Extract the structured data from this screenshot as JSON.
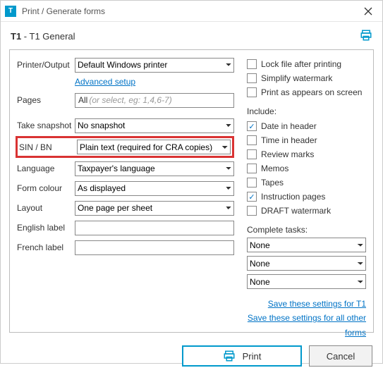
{
  "titlebar": {
    "title": "Print / Generate forms"
  },
  "subheader": {
    "code": "T1",
    "name": "T1 General"
  },
  "left": {
    "printerOutput": {
      "label": "Printer/Output",
      "value": "Default Windows printer"
    },
    "advancedSetup": "Advanced setup",
    "pages": {
      "label": "Pages",
      "prefix": "All",
      "hint": "(or select, eg: 1,4,6-7)"
    },
    "snapshot": {
      "label": "Take snapshot",
      "value": "No snapshot"
    },
    "sinbn": {
      "label": "SIN / BN",
      "value": "Plain text (required for CRA copies)"
    },
    "language": {
      "label": "Language",
      "value": "Taxpayer's language"
    },
    "formColour": {
      "label": "Form colour",
      "value": "As displayed"
    },
    "layout": {
      "label": "Layout",
      "value": "One page per sheet"
    },
    "englishLabel": {
      "label": "English label",
      "value": ""
    },
    "frenchLabel": {
      "label": "French label",
      "value": ""
    }
  },
  "right": {
    "top": [
      {
        "label": "Lock file after printing",
        "checked": false
      },
      {
        "label": "Simplify watermark",
        "checked": false
      },
      {
        "label": "Print as appears on screen",
        "checked": false
      }
    ],
    "includeLabel": "Include:",
    "include": [
      {
        "label": "Date in header",
        "checked": true
      },
      {
        "label": "Time in header",
        "checked": false
      },
      {
        "label": "Review marks",
        "checked": false
      },
      {
        "label": "Memos",
        "checked": false
      },
      {
        "label": "Tapes",
        "checked": false
      },
      {
        "label": "Instruction pages",
        "checked": true
      },
      {
        "label": "DRAFT watermark",
        "checked": false
      }
    ],
    "completeLabel": "Complete tasks:",
    "tasks": [
      "None",
      "None",
      "None"
    ],
    "saveT1": "Save these settings for T1",
    "saveAll": "Save these settings for all other forms"
  },
  "footer": {
    "print": "Print",
    "cancel": "Cancel"
  }
}
